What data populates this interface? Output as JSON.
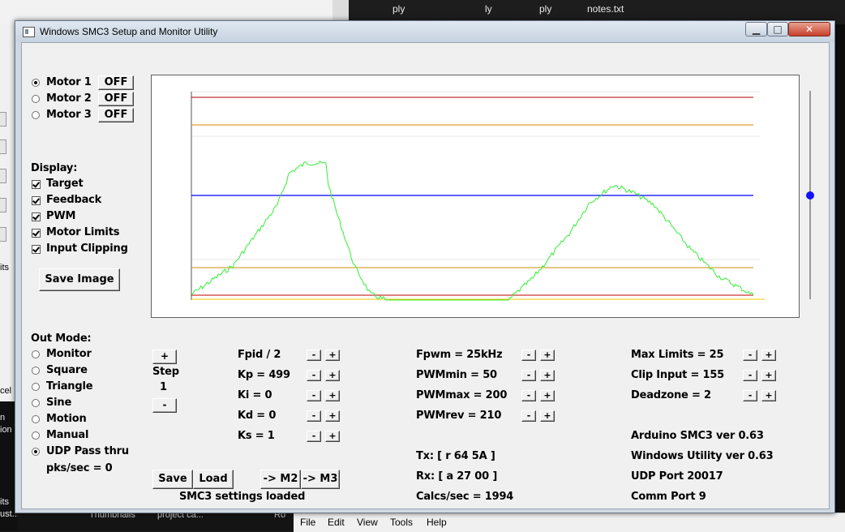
{
  "background": {
    "top_right_texts": [
      "ply",
      "ly",
      "ply",
      "notes.txt"
    ],
    "left_texts": [
      "its",
      "cel"
    ],
    "left_dark_texts": [
      "n",
      "ion",
      "its",
      "ust..."
    ],
    "bottom_texts": [
      "Thumbnails",
      "project ca...",
      "Ro"
    ],
    "menubar": [
      "File",
      "Edit",
      "View",
      "Tools",
      "Help"
    ]
  },
  "window": {
    "title": "Windows SMC3 Setup and Monitor Utility",
    "minimize_glyph": "▁",
    "maximize_glyph": "□",
    "close_glyph": "✕"
  },
  "motors": [
    {
      "label": "Motor 1",
      "button": "OFF",
      "selected": true
    },
    {
      "label": "Motor 2",
      "button": "OFF",
      "selected": false
    },
    {
      "label": "Motor 3",
      "button": "OFF",
      "selected": false
    }
  ],
  "display": {
    "heading": "Display:",
    "options": [
      "Target",
      "Feedback",
      "PWM",
      "Motor Limits",
      "Input Clipping"
    ],
    "save_image": "Save Image"
  },
  "out_mode": {
    "heading": "Out Mode:",
    "options": [
      "Monitor",
      "Square",
      "Triangle",
      "Sine",
      "Motion",
      "Manual",
      "UDP Pass thru"
    ],
    "selected": "UDP Pass thru",
    "pks_sec": "pks/sec = 0"
  },
  "step": {
    "plus": "+",
    "label": "Step",
    "value": "1",
    "minus": "-"
  },
  "pid": [
    "Fpid / 2",
    "Kp = 499",
    "Ki = 0",
    "Kd = 0",
    "Ks = 1"
  ],
  "pwm": [
    "Fpwm = 25kHz",
    "PWMmin = 50",
    "PWMmax = 200",
    "PWMrev = 210"
  ],
  "limits": [
    "Max Limits = 25",
    "Clip Input = 155",
    "Deadzone = 2"
  ],
  "stepper": {
    "minus": "-",
    "plus": "+"
  },
  "comm": {
    "tx": "Tx: [ r 64 5A ]",
    "rx": "Rx: [ a 27 00 ]",
    "calcs": "Calcs/sec = 1994"
  },
  "info": [
    "Arduino SMC3 ver 0.63",
    "Windows Utility ver 0.63",
    "UDP Port 20017",
    "Comm Port 9"
  ],
  "buttons": {
    "save": "Save",
    "load": "Load",
    "to_m2": "-> M2",
    "to_m3": "-> M3",
    "status": "SMC3 settings loaded"
  },
  "colors": {
    "target": "#0000ff",
    "feedback": "#33ee33",
    "motor_limit": "#c00000",
    "clip_limit": "#e08000",
    "deadzone": "#e0d000",
    "window_frame": "#cfd9e4",
    "close_button": "#c7402b"
  }
}
